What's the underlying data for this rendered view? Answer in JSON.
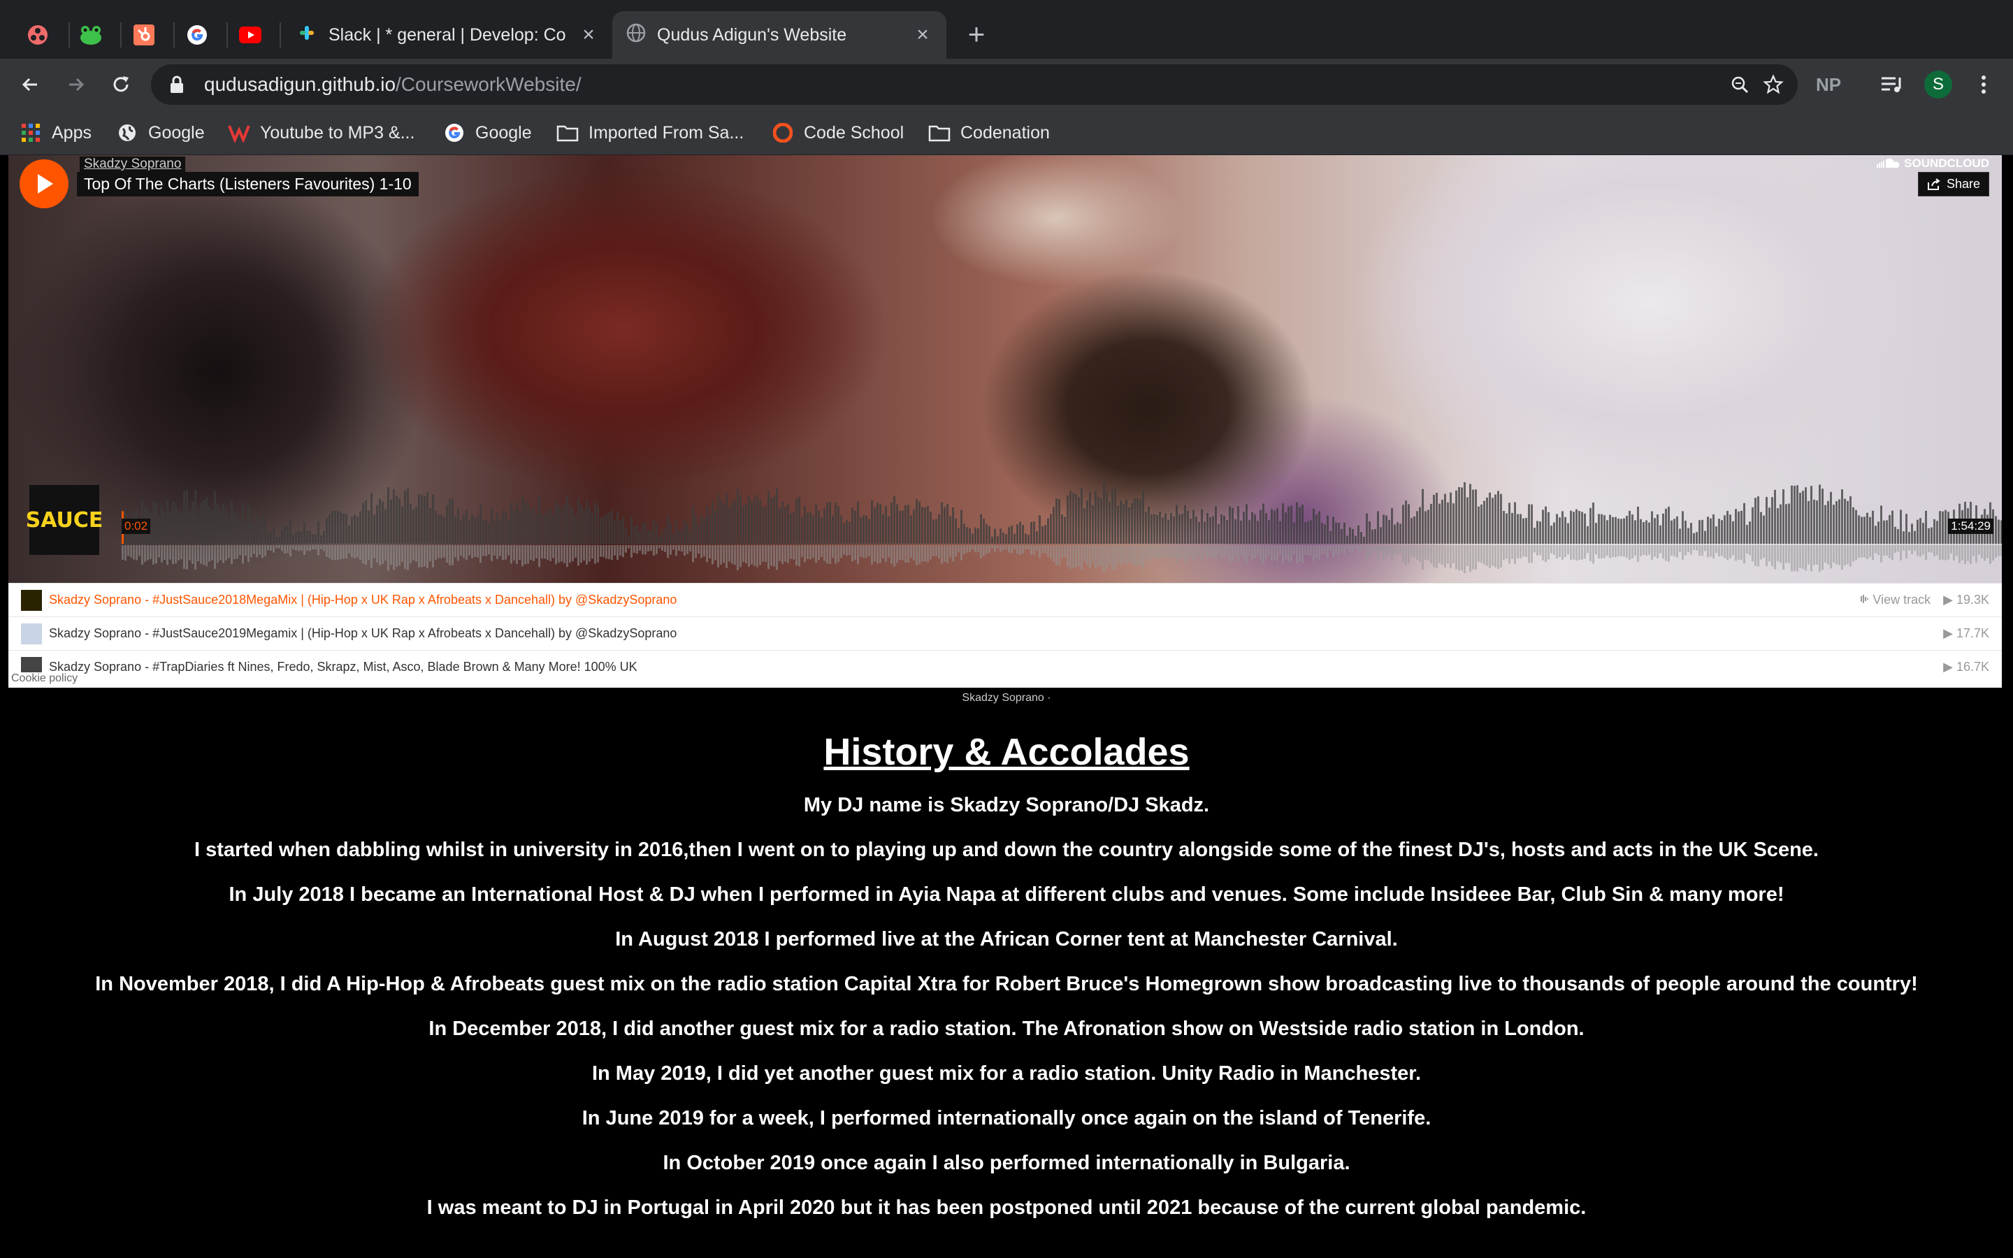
{
  "browser": {
    "tabs": [
      {
        "title": "Slack | * general | Develop: Co",
        "active": false
      },
      {
        "title": "Qudus Adigun's Website",
        "active": true
      }
    ],
    "pinned_tabs": [
      "asana-icon",
      "frog-icon",
      "hubspot-icon",
      "google-icon",
      "youtube-icon"
    ],
    "url_host": "qudusadigun.github.io",
    "url_path": "/CourseworkWebsite/",
    "extension_np": "NP",
    "profile_initial": "S",
    "bookmarks": [
      "Apps",
      "Google",
      "Youtube to MP3 &...",
      "Google",
      "Imported From Sa...",
      "Code School",
      "Codenation"
    ]
  },
  "soundcloud": {
    "user": "Skadzy Soprano",
    "track_title": "Top Of The Charts (Listeners Favourites) 1-10",
    "logo_text": "SOUNDCLOUD",
    "share_label": "Share",
    "thumb_text": "SAUCE",
    "current_time": "0:02",
    "duration": "1:54:29",
    "view_track": "View track",
    "tracks": [
      {
        "title": "Skadzy Soprano - #JustSauce2018MegaMix | (Hip-Hop x UK Rap x Afrobeats x Dancehall) by @SkadzySoprano",
        "plays": "19.3K"
      },
      {
        "title": "Skadzy Soprano - #JustSauce2019Megamix | (Hip-Hop x UK Rap x Afrobeats x Dancehall) by @SkadzySoprano",
        "plays": "17.7K"
      },
      {
        "title": "Skadzy Soprano - #TrapDiaries ft Nines, Fredo, Skrapz, Mist, Asco, Blade Brown & Many More! 100% UK",
        "plays": "16.7K"
      }
    ],
    "cookie_policy": "Cookie policy",
    "credit": "Skadzy Soprano ·"
  },
  "content": {
    "heading": "History & Accolades",
    "paragraphs": [
      "My DJ name is Skadzy Soprano/DJ Skadz.",
      "I started when dabbling whilst in university in 2016,then I went on to playing up and down the country alongside some of the finest DJ's, hosts and acts in the UK Scene.",
      "In July 2018 I became an International Host & DJ when I performed in Ayia Napa at different clubs and venues. Some include Insideee Bar, Club Sin & many more!",
      "In August 2018 I performed live at the African Corner tent at Manchester Carnival.",
      "In November 2018, I did A Hip-Hop & Afrobeats guest mix on the radio station Capital Xtra for Robert Bruce's Homegrown show broadcasting live to thousands of people around the country!",
      "In December 2018, I did another guest mix for a radio station. The Afronation show on Westside radio station in London.",
      "In May 2019, I did yet another guest mix for a radio station. Unity Radio in Manchester.",
      "In June 2019 for a week, I performed internationally once again on the island of Tenerife.",
      "In October 2019 once again I also performed internationally in Bulgaria.",
      "I was meant to DJ in Portugal in April 2020 but it has been postponed until 2021 because of the current global pandemic."
    ]
  },
  "colors": {
    "soundcloud_orange": "#ff5500",
    "chrome_dark": "#202124",
    "chrome_toolbar": "#35363a"
  }
}
